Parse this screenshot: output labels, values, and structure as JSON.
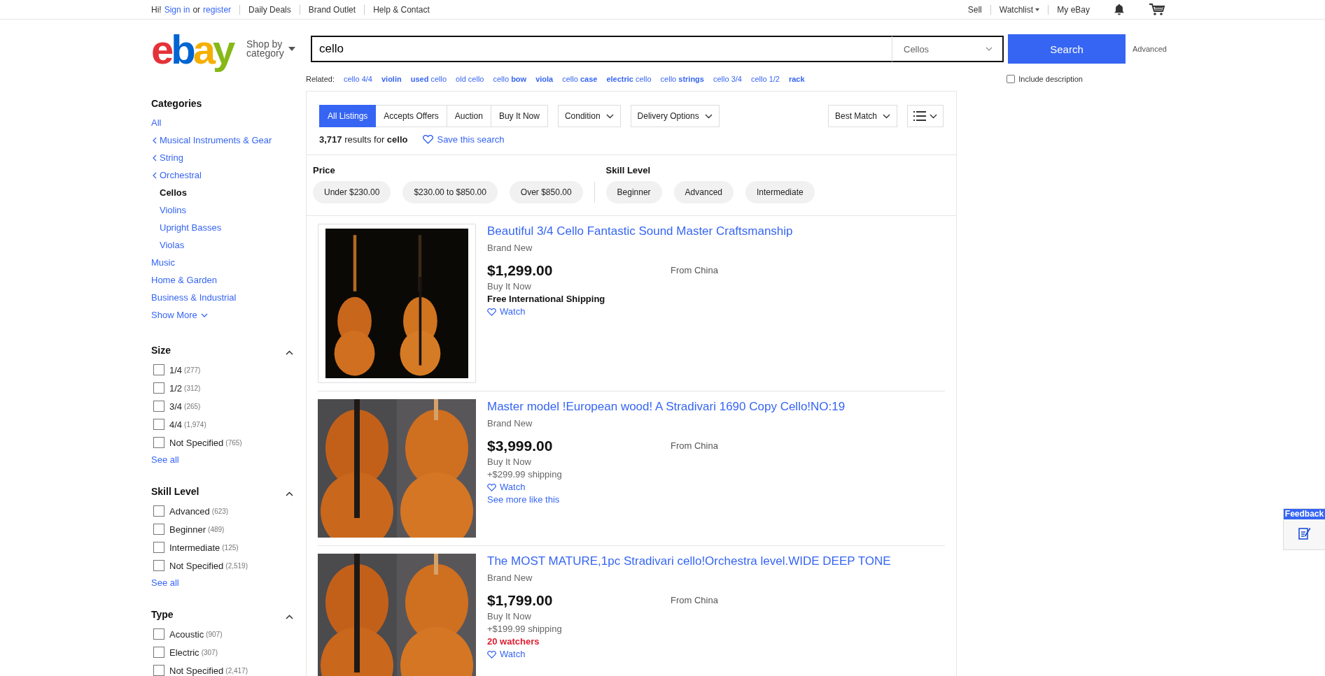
{
  "top_nav": {
    "greeting": "Hi!",
    "sign_in": "Sign in",
    "or": "or",
    "register": "register",
    "links": [
      "Daily Deals",
      "Brand Outlet",
      "Help & Contact"
    ],
    "sell": "Sell",
    "watchlist": "Watchlist",
    "my_ebay": "My eBay"
  },
  "header": {
    "logo": "ebay",
    "shop_by": "Shop by",
    "category": "category",
    "search": {
      "value": "cello",
      "category": "Cellos",
      "button": "Search"
    },
    "advanced": "Advanced",
    "include_description": {
      "label": "Include description",
      "checked": false
    }
  },
  "related": {
    "label": "Related:",
    "items": [
      "cello 4/4",
      "**violin**",
      "**used** cello",
      "old cello",
      "cello **bow**",
      "**viola**",
      "cello **case**",
      "**electric** cello",
      "cello **strings**",
      "cello 3/4",
      "cello 1/2",
      "**rack**"
    ]
  },
  "sidebar": {
    "categories_title": "Categories",
    "categories": [
      {
        "label": "All",
        "kind": "top"
      },
      {
        "label": "Musical Instruments & Gear",
        "kind": "parent"
      },
      {
        "label": "String",
        "kind": "parent"
      },
      {
        "label": "Orchestral",
        "kind": "parent"
      },
      {
        "label": "Cellos",
        "kind": "current"
      },
      {
        "label": "Violins",
        "kind": "child"
      },
      {
        "label": "Upright Basses",
        "kind": "child"
      },
      {
        "label": "Violas",
        "kind": "child"
      },
      {
        "label": "Music",
        "kind": "top"
      },
      {
        "label": "Home & Garden",
        "kind": "top"
      },
      {
        "label": "Business & Industrial",
        "kind": "top"
      }
    ],
    "show_more": "Show More",
    "filters": [
      {
        "title": "Size",
        "expanded": true,
        "options": [
          {
            "label": "1/4",
            "count": "(277)",
            "checked": false
          },
          {
            "label": "1/2",
            "count": "(312)",
            "checked": false
          },
          {
            "label": "3/4",
            "count": "(265)",
            "checked": false
          },
          {
            "label": "4/4",
            "count": "(1,974)",
            "checked": false
          },
          {
            "label": "Not Specified",
            "count": "(765)",
            "checked": false
          }
        ],
        "see_all": "See all"
      },
      {
        "title": "Skill Level",
        "expanded": true,
        "options": [
          {
            "label": "Advanced",
            "count": "(623)",
            "checked": false
          },
          {
            "label": "Beginner",
            "count": "(489)",
            "checked": false
          },
          {
            "label": "Intermediate",
            "count": "(125)",
            "checked": false
          },
          {
            "label": "Not Specified",
            "count": "(2,519)",
            "checked": false
          }
        ],
        "see_all": "See all"
      },
      {
        "title": "Type",
        "expanded": true,
        "options": [
          {
            "label": "Acoustic",
            "count": "(907)",
            "checked": false
          },
          {
            "label": "Electric",
            "count": "(307)",
            "checked": false
          },
          {
            "label": "Not Specified",
            "count": "(2,417)",
            "checked": false
          }
        ]
      }
    ]
  },
  "results": {
    "tabs": [
      {
        "label": "All Listings",
        "selected": true
      },
      {
        "label": "Accepts Offers",
        "selected": false
      },
      {
        "label": "Auction",
        "selected": false
      },
      {
        "label": "Buy It Now",
        "selected": false
      }
    ],
    "dropdowns": [
      "Condition",
      "Delivery Options"
    ],
    "sort": "Best Match",
    "count_text": "**3,717** results for **cello**",
    "save_search": "Save this search",
    "guidance": [
      {
        "title": "Price",
        "chips": [
          "Under $230.00",
          "$230.00 to $850.00",
          "Over $850.00"
        ]
      },
      {
        "title": "Skill Level",
        "chips": [
          "Beginner",
          "Advanced",
          "Intermediate"
        ]
      }
    ],
    "listings": [
      {
        "framed": true,
        "title": "Beautiful 3/4 Cello Fantastic Sound Master Craftsmanship",
        "condition": "Brand New",
        "price": "$1,299.00",
        "format": "Buy It Now",
        "shipping": "Free International Shipping",
        "free_shipping": true,
        "watch": "Watch",
        "location": "From China"
      },
      {
        "framed": false,
        "title": "Master model !European wood! A Stradivari 1690 Copy Cello!NO:19",
        "condition": "Brand New",
        "price": "$3,999.00",
        "format": "Buy It Now",
        "shipping": "+$299.99 shipping",
        "free_shipping": false,
        "watch": "Watch",
        "more_like": "See more like this",
        "location": "From China"
      },
      {
        "framed": false,
        "title": "The MOST MATURE,1pc Stradivari cello!Orchestra level.WIDE DEEP TONE",
        "condition": "Brand New",
        "price": "$1,799.00",
        "format": "Buy It Now",
        "shipping": "+$199.99 shipping",
        "free_shipping": false,
        "watchers": "20 watchers",
        "watch": "Watch",
        "location": "From China"
      }
    ]
  },
  "feedback": {
    "label": "Feedback"
  }
}
